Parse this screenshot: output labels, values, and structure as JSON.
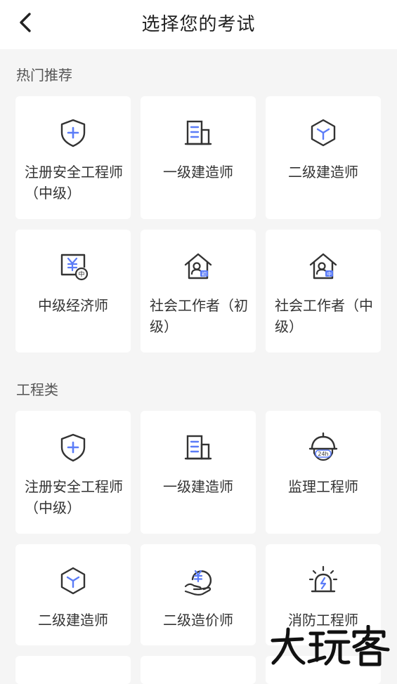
{
  "header": {
    "title": "选择您的考试"
  },
  "sections": [
    {
      "title": "热门推荐",
      "cards": [
        {
          "label": "注册安全工程师（中级）",
          "icon": "shield-plus-icon"
        },
        {
          "label": "一级建造师",
          "icon": "building-icon"
        },
        {
          "label": "二级建造师",
          "icon": "hexagon-box-icon"
        },
        {
          "label": "中级经济师",
          "icon": "yuan-board-icon"
        },
        {
          "label": "社会工作者（初级）",
          "icon": "house-person-icon",
          "badge": "初"
        },
        {
          "label": "社会工作者（中级）",
          "icon": "house-person-icon",
          "badge": "中"
        }
      ]
    },
    {
      "title": "工程类",
      "cards": [
        {
          "label": "注册安全工程师（中级）",
          "icon": "shield-plus-icon"
        },
        {
          "label": "一级建造师",
          "icon": "building-icon"
        },
        {
          "label": "监理工程师",
          "icon": "helmet-24h-icon",
          "badge": "24h"
        },
        {
          "label": "二级建造师",
          "icon": "hexagon-box-icon"
        },
        {
          "label": "二级造价师",
          "icon": "hand-yuan-icon"
        },
        {
          "label": "消防工程师",
          "icon": "alarm-light-icon"
        }
      ]
    }
  ],
  "colors": {
    "accent": "#5b7cf7",
    "line": "#333333",
    "card_bg": "#ffffff",
    "page_bg": "#f5f5f5"
  }
}
